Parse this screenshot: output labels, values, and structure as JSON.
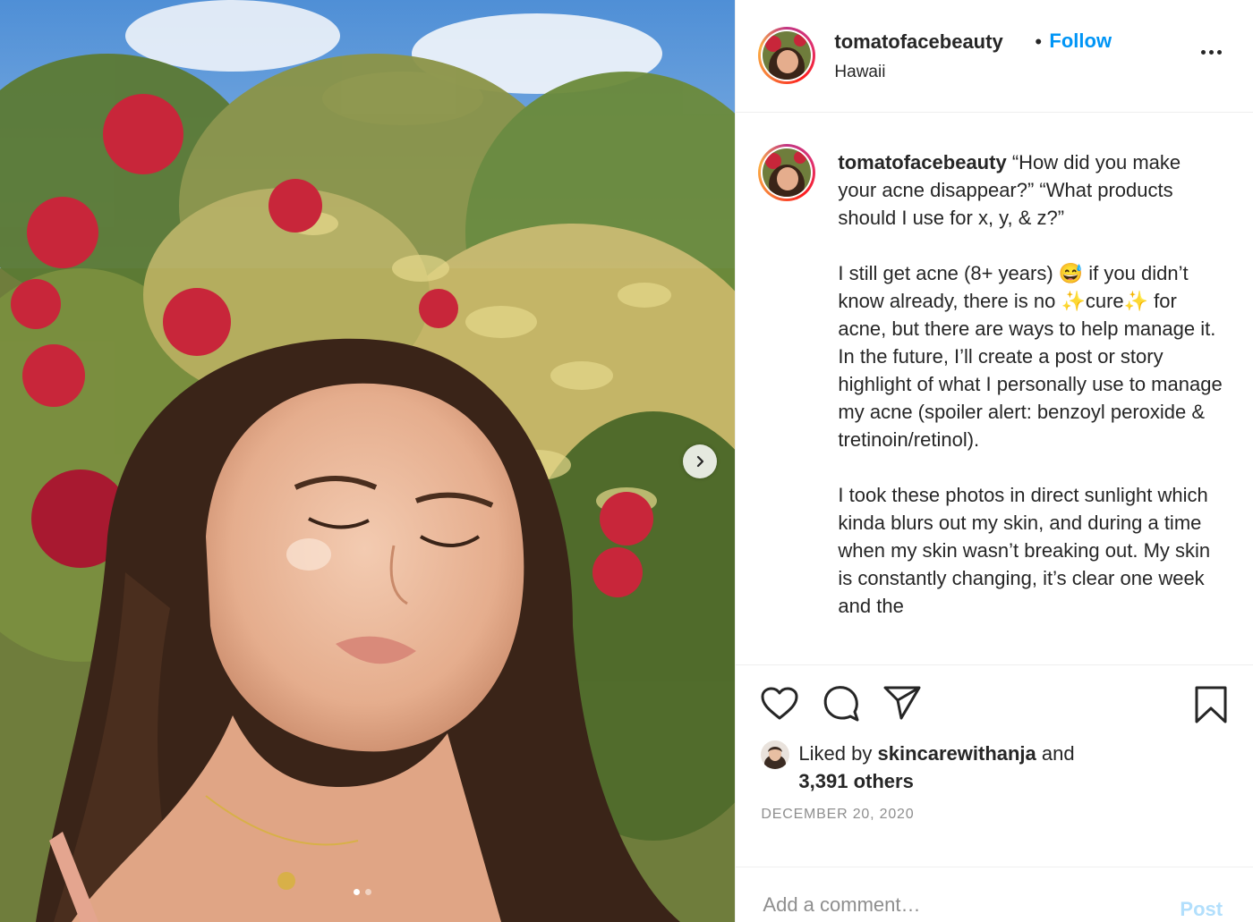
{
  "post": {
    "username": "tomatofacebeauty",
    "separator": "•",
    "follow_label": "Follow",
    "location": "Hawaii",
    "more_icon": "more-horizontal-icon"
  },
  "caption": {
    "username": "tomatofacebeauty",
    "lines": [
      "“How did you make your acne disappear?” “What products should I use for x, y, & z?”",
      "I still get acne (8+ years) 😅 if you didn’t know already, there is no ✨cure✨ for acne, but there are ways to help manage it. In the future, I’ll create a post or story highlight of what I personally use to manage my acne (spoiler alert: benzoyl peroxide & tretinoin/retinol).",
      "I took these photos in direct sunlight which kinda blurs out my skin, and during a time when my skin wasn’t breaking out. My skin is constantly changing, it’s clear one week and the"
    ]
  },
  "actions": {
    "like_icon": "heart-icon",
    "comment_icon": "comment-icon",
    "share_icon": "paper-plane-icon",
    "save_icon": "bookmark-icon"
  },
  "likes": {
    "prefix": "Liked by",
    "user": "skincarewithanja",
    "and": "and",
    "others": "3,391 others"
  },
  "date": "DECEMBER 20, 2020",
  "comment": {
    "placeholder": "Add a comment…",
    "post_label": "Post"
  },
  "carousel": {
    "slide_count": 2,
    "active_index": 0
  },
  "colors": {
    "accent": "#0095f6",
    "post_disabled": "#b2dffc",
    "muted": "#8e8e8e"
  }
}
